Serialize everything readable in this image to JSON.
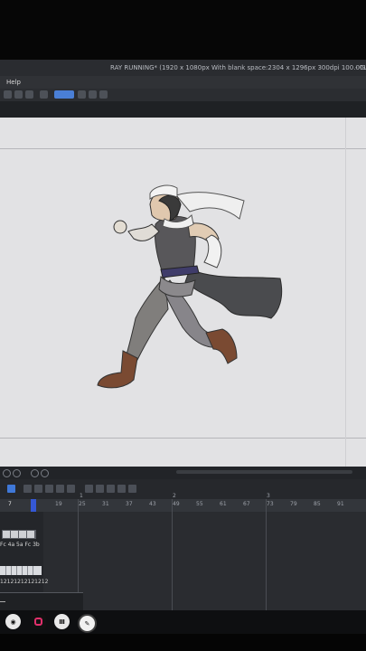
{
  "window": {
    "title": "RAY RUNNING* (1920 x 1080px With blank space:2304 x 1296px 300dpi 100.0%)",
    "title_suffix": "- CLI"
  },
  "menu": {
    "items": [
      "Help"
    ]
  },
  "toolbar": {
    "icons": [
      "layer-icon",
      "fill-icon",
      "select-icon",
      "transform-icon",
      "lasso-icon",
      "pen-icon",
      "eraser-icon",
      "settings-icon"
    ]
  },
  "timeline": {
    "current_frame": "7",
    "frame_numbers": [
      "19",
      "25",
      "31",
      "37",
      "43",
      "49",
      "55",
      "61",
      "67",
      "73",
      "79",
      "85",
      "91"
    ],
    "section_markers": [
      "1",
      "2",
      "3"
    ],
    "cel_labels": "Fc 4a 5a Fc 3b",
    "cel_sequence": "12121212121212",
    "play_controls": [
      "play-icon",
      "stop-icon",
      "loop-icon"
    ]
  },
  "taskbar": {
    "apps": [
      {
        "name": "obs-icon",
        "label": ""
      },
      {
        "name": "instagram-icon",
        "label": ""
      },
      {
        "name": "app-icon",
        "label": ""
      },
      {
        "name": "clip-studio-icon",
        "label": ""
      }
    ]
  },
  "colors": {
    "canvas_bg": "#e2e2e4",
    "ui_dark": "#2c2e32",
    "accent": "#3558d4",
    "playhead": "#3558d4"
  }
}
